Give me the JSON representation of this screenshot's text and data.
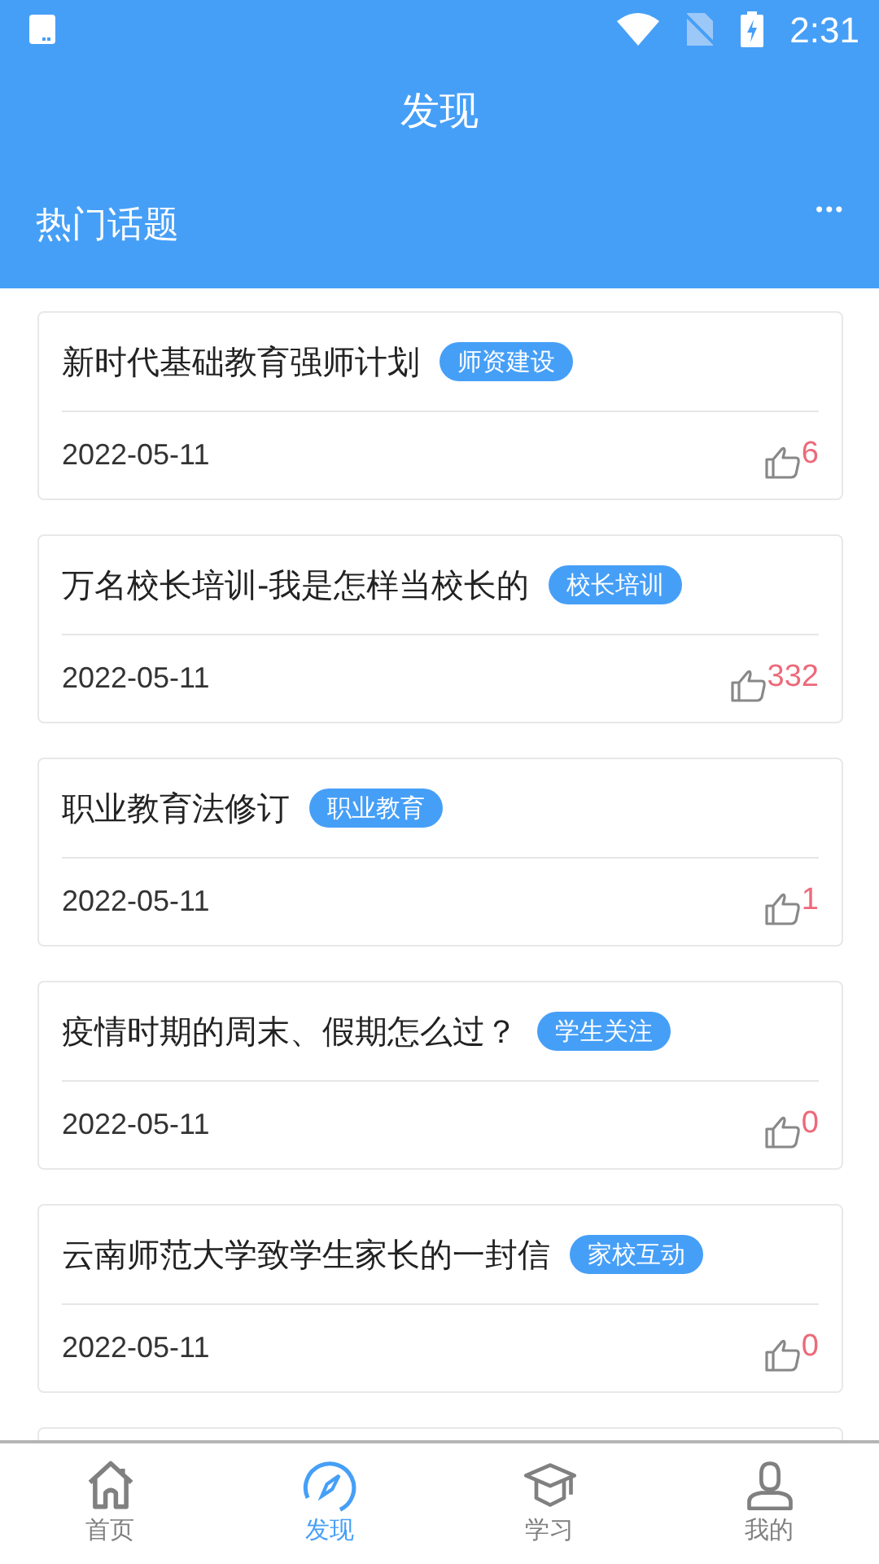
{
  "status_bar": {
    "time": "2:31"
  },
  "header": {
    "title": "发现"
  },
  "section": {
    "title": "热门话题",
    "more": "•••"
  },
  "topics": [
    {
      "title": "新时代基础教育强师计划",
      "tag": "师资建设",
      "date": "2022-05-11",
      "likes": "6"
    },
    {
      "title": "万名校长培训-我是怎样当校长的",
      "tag": "校长培训",
      "date": "2022-05-11",
      "likes": "332"
    },
    {
      "title": "职业教育法修订",
      "tag": "职业教育",
      "date": "2022-05-11",
      "likes": "1"
    },
    {
      "title": "疫情时期的周末、假期怎么过？",
      "tag": "学生关注",
      "date": "2022-05-11",
      "likes": "0"
    },
    {
      "title": "云南师范大学致学生家长的一封信",
      "tag": "家校互动",
      "date": "2022-05-11",
      "likes": "0"
    }
  ],
  "bottom_nav": [
    {
      "kind": "home",
      "label": "首页",
      "selected": false
    },
    {
      "kind": "discover",
      "label": "发现",
      "selected": true
    },
    {
      "kind": "study",
      "label": "学习",
      "selected": false
    },
    {
      "kind": "me",
      "label": "我的",
      "selected": false
    }
  ]
}
